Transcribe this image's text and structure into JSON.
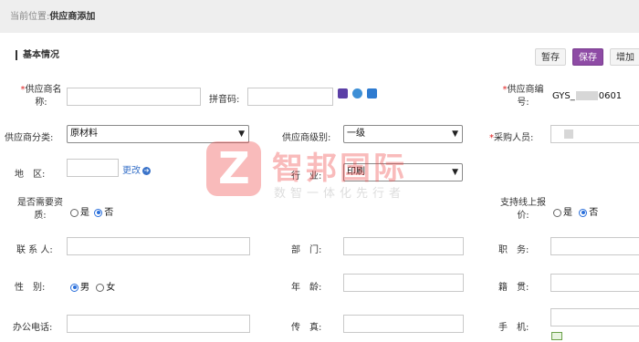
{
  "breadcrumb": {
    "prefix": "当前位置:",
    "current": "供应商添加"
  },
  "section_title": "基本情况",
  "toolbar": {
    "draft": "暂存",
    "save": "保存",
    "add": "增加"
  },
  "fields": {
    "supplier_name": {
      "line1": "供应商名",
      "line2": "称:",
      "required": "*"
    },
    "pinyin": {
      "label": "拼音码:"
    },
    "supplier_code": {
      "line1": "供应商编",
      "line2": "号:",
      "required": "*",
      "value_a": "GYS_",
      "value_b": "0601"
    },
    "category": {
      "label": "供应商分类:",
      "value": "原材料"
    },
    "level": {
      "label": "供应商级别:",
      "value": "一级"
    },
    "buyer": {
      "label": "采购人员:",
      "required": "*"
    },
    "region": {
      "label": "地　区:",
      "change": "更改"
    },
    "industry": {
      "label": "行　业:",
      "value": "印刷"
    },
    "need_qual": {
      "line1": "是否需要资",
      "line2": "质:",
      "yes": "是",
      "no": "否"
    },
    "online_quote": {
      "line1": "支持线上报",
      "line2": "价:",
      "yes": "是",
      "no": "否"
    },
    "contact": {
      "label": "联 系 人:"
    },
    "dept": {
      "label": "部　门:"
    },
    "position": {
      "label": "职　务:"
    },
    "gender": {
      "label": "性　别:",
      "male": "男",
      "female": "女"
    },
    "age": {
      "label": "年　龄:"
    },
    "origin": {
      "label": "籍　贯:"
    },
    "office_phone": {
      "label": "办公电话:"
    },
    "fax": {
      "label": "传　真:"
    },
    "mobile": {
      "label": "手　机:"
    }
  },
  "watermark": {
    "name": "智邦国际",
    "slogan": "数智一体化先行者"
  },
  "colors": {
    "accent": "#8e4ba5",
    "required": "#e02020",
    "link": "#3a73c9"
  }
}
